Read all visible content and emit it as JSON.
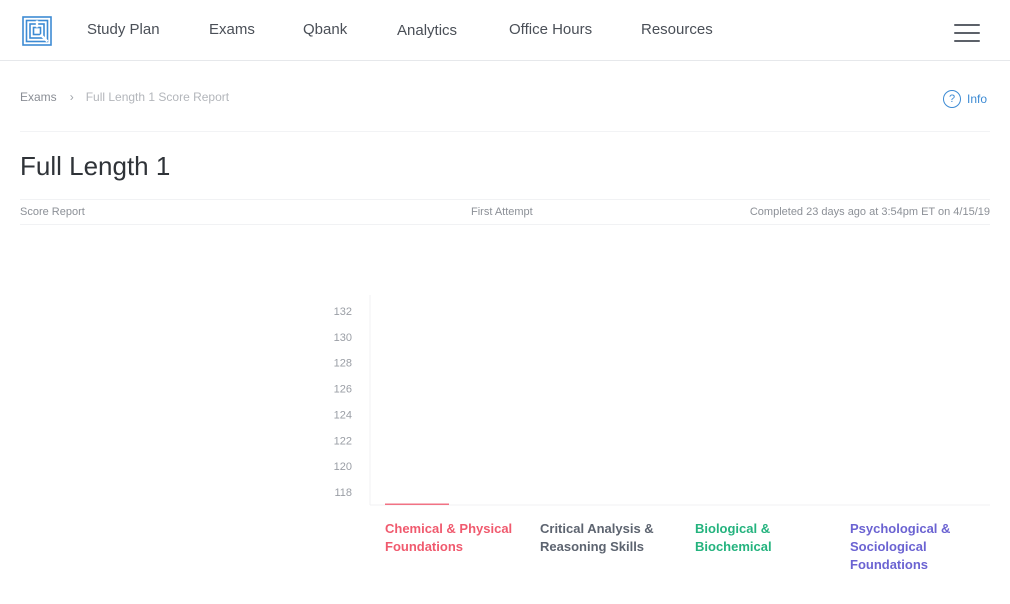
{
  "nav": {
    "items": [
      {
        "label": "Study Plan",
        "name": "nav-study-plan"
      },
      {
        "label": "Exams",
        "name": "nav-exams"
      },
      {
        "label": "Qbank",
        "name": "nav-qbank"
      },
      {
        "label": "Analytics",
        "name": "nav-analytics"
      },
      {
        "label": "Office Hours",
        "name": "nav-office-hours"
      },
      {
        "label": "Resources",
        "name": "nav-resources"
      }
    ],
    "logo_icon": "maze-logo-icon",
    "menu_icon": "hamburger-menu-icon",
    "accent": "#3d8bd4"
  },
  "breadcrumb": {
    "parent": "Exams",
    "separator": "›",
    "current": "Full Length 1 Score Report"
  },
  "info": {
    "icon_glyph": "?",
    "label": "Info"
  },
  "page": {
    "title": "Full Length 1",
    "report_label": "Score Report",
    "attempt": "First Attempt",
    "completed": "Completed 23 days ago at 3:54pm ET on 4/15/19"
  },
  "chart_data": {
    "type": "bar",
    "title": "",
    "xlabel": "",
    "ylabel": "",
    "ylim": [
      117,
      132
    ],
    "yticks": [
      118,
      120,
      122,
      124,
      126,
      128,
      130,
      132
    ],
    "grid": false,
    "categories": [
      {
        "line1": "Chemical & Physical",
        "line2": "Foundations",
        "line3": "",
        "color": "#f05a6e"
      },
      {
        "line1": "Critical Analysis &",
        "line2": "Reasoning Skills",
        "line3": "",
        "color": "#5d6470"
      },
      {
        "line1": "Biological &",
        "line2": "Biochemical",
        "line3": "",
        "color": "#24b37e"
      },
      {
        "line1": "Psychological &",
        "line2": "Sociological",
        "line3": "Foundations",
        "color": "#6b63d2"
      }
    ],
    "values": [
      117,
      117,
      117,
      117
    ]
  }
}
